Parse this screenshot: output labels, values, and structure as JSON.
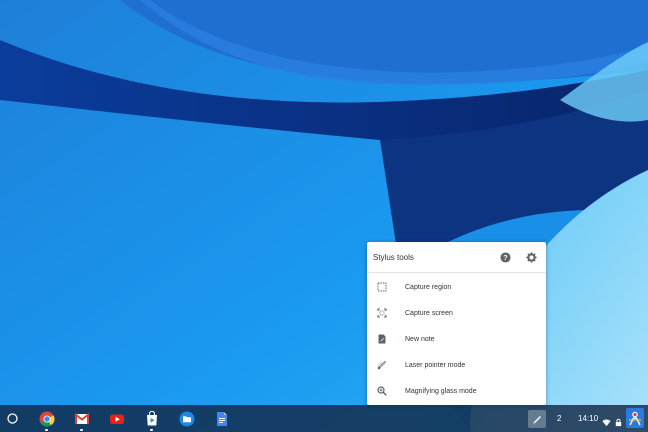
{
  "popup": {
    "title": "Stylus tools",
    "help_icon": "help-icon",
    "settings_icon": "gear-icon",
    "items": [
      {
        "label": "Capture region",
        "icon": "capture-region-icon"
      },
      {
        "label": "Capture screen",
        "icon": "capture-screen-icon"
      },
      {
        "label": "New note",
        "icon": "new-note-icon"
      },
      {
        "label": "Laser pointer mode",
        "icon": "laser-pointer-icon"
      },
      {
        "label": "Magnifying glass mode",
        "icon": "magnifier-icon"
      }
    ]
  },
  "shelf": {
    "apps": [
      {
        "name": "Chrome",
        "icon": "chrome-icon",
        "running": true
      },
      {
        "name": "Gmail",
        "icon": "gmail-icon",
        "running": true
      },
      {
        "name": "YouTube",
        "icon": "youtube-icon",
        "running": false
      },
      {
        "name": "Play Store",
        "icon": "play-store-icon",
        "running": true
      },
      {
        "name": "Files",
        "icon": "files-icon",
        "running": false
      },
      {
        "name": "Docs",
        "icon": "docs-icon",
        "running": false
      }
    ]
  },
  "tray": {
    "notification_count": "2",
    "time": "14:10"
  },
  "colors": {
    "accent": "#1b8ae0",
    "shelf": "#122846"
  }
}
